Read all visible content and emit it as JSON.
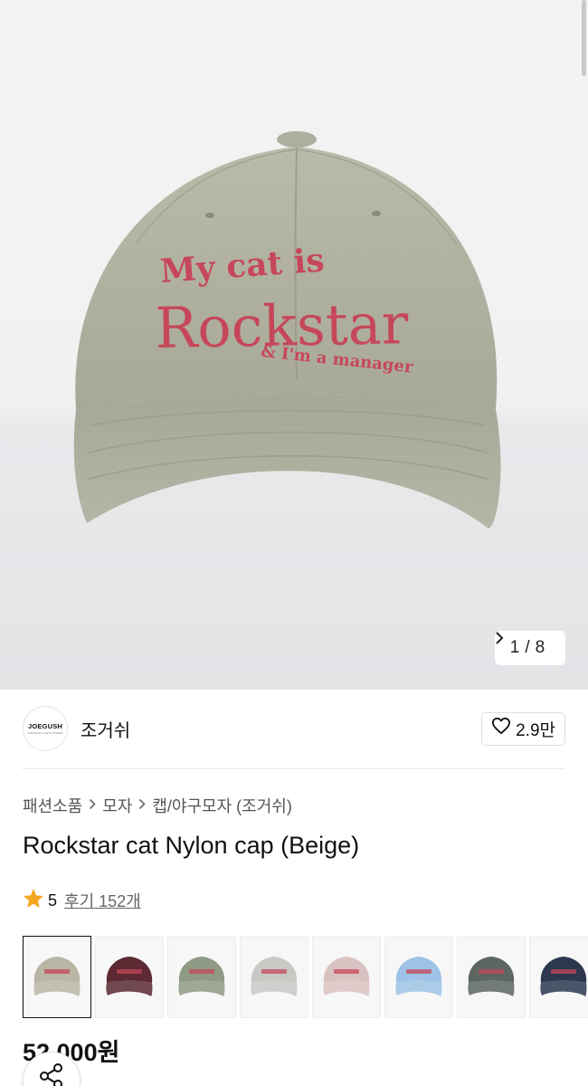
{
  "gallery": {
    "cap_text": {
      "line1": "My cat is",
      "line2": "Rockstar",
      "line3": "& I'm a manager"
    },
    "pager": {
      "current": "1",
      "separator": "/",
      "total": "8"
    }
  },
  "brand": {
    "logo_text": "JOEGUSH",
    "logo_subtext": "SOLIVAGE & KEYS STUDIO",
    "name": "조거쉬",
    "like_count": "2.9만"
  },
  "breadcrumb": [
    "패션소품",
    "모자",
    "캡/야구모자 (조거쉬)"
  ],
  "product": {
    "title": "Rockstar cat Nylon cap (Beige)",
    "rating": "5",
    "review_label": "후기 152개",
    "price": "52,000원"
  },
  "swatches": [
    {
      "color": "#b9b6a6",
      "selected": true
    },
    {
      "color": "#5b2a33",
      "selected": false
    },
    {
      "color": "#8e9a84",
      "selected": false
    },
    {
      "color": "#c6c9c4",
      "selected": false
    },
    {
      "color": "#d9c3c2",
      "selected": false
    },
    {
      "color": "#9ec3e6",
      "selected": false
    },
    {
      "color": "#5d6661",
      "selected": false
    },
    {
      "color": "#2d3850",
      "selected": false
    }
  ],
  "colors": {
    "cap": "#b3b2a2",
    "embroidery": "#c6475a",
    "star": "#f5a623"
  },
  "icons": {
    "pager_next": "chevron-right-icon",
    "like": "heart-outline-icon",
    "rating": "star-icon",
    "share": "share-icon"
  }
}
